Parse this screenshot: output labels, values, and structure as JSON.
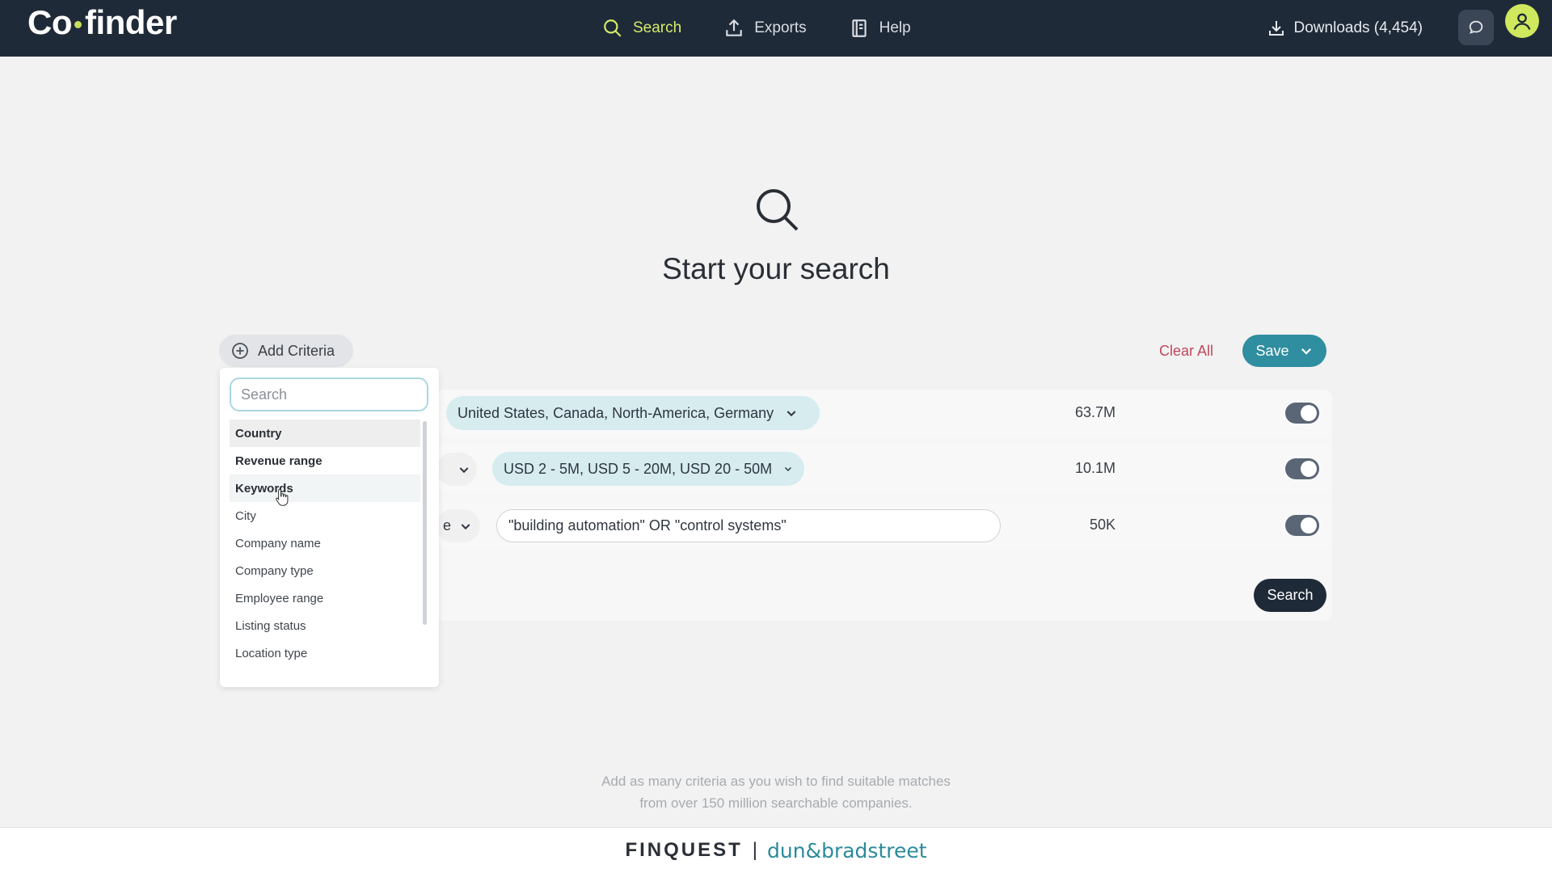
{
  "app": {
    "logo_left": "Co",
    "logo_right": "finder"
  },
  "nav": {
    "items": [
      {
        "label": "Search",
        "icon": "search-icon",
        "active": true
      },
      {
        "label": "Exports",
        "icon": "upload-icon",
        "active": false
      },
      {
        "label": "Help",
        "icon": "book-icon",
        "active": false
      }
    ],
    "downloads": "Downloads (4,454)"
  },
  "hero": {
    "title": "Start your search"
  },
  "toolbar": {
    "add_criteria": "Add Criteria",
    "clear_all": "Clear All",
    "save": "Save"
  },
  "criteria": [
    {
      "value": "United States, Canada, North-America, Germany",
      "count": "63.7M",
      "enabled": true
    },
    {
      "value": "USD 2 - 5M, USD 5 - 20M, USD 20 - 50M",
      "count": "10.1M",
      "enabled": true
    },
    {
      "left_fragment": "e",
      "value": "\"building automation\" OR \"control systems\"",
      "count": "50K",
      "enabled": true
    }
  ],
  "search_button": "Search",
  "dropdown": {
    "placeholder": "Search",
    "items": [
      {
        "label": "Country",
        "bold": true,
        "state": "selected"
      },
      {
        "label": "Revenue range",
        "bold": true,
        "state": ""
      },
      {
        "label": "Keywords",
        "bold": true,
        "state": "hover"
      },
      {
        "label": "City",
        "bold": false,
        "state": ""
      },
      {
        "label": "Company name",
        "bold": false,
        "state": ""
      },
      {
        "label": "Company type",
        "bold": false,
        "state": ""
      },
      {
        "label": "Employee range",
        "bold": false,
        "state": ""
      },
      {
        "label": "Listing status",
        "bold": false,
        "state": ""
      },
      {
        "label": "Location type",
        "bold": false,
        "state": ""
      }
    ]
  },
  "hint": {
    "line1": "Add as many criteria as you wish to find suitable matches",
    "line2": "from over 150 million searchable companies."
  },
  "footer": {
    "brand1": "FINQUEST",
    "separator": "|",
    "brand2": "dun&bradstreet"
  },
  "colors": {
    "nav_bg": "#1f2a38",
    "accent_lime": "#d6ea6a",
    "save_teal": "#2f8ea0",
    "clear_red": "#c0475b",
    "chip_bg": "#d6ecef"
  }
}
